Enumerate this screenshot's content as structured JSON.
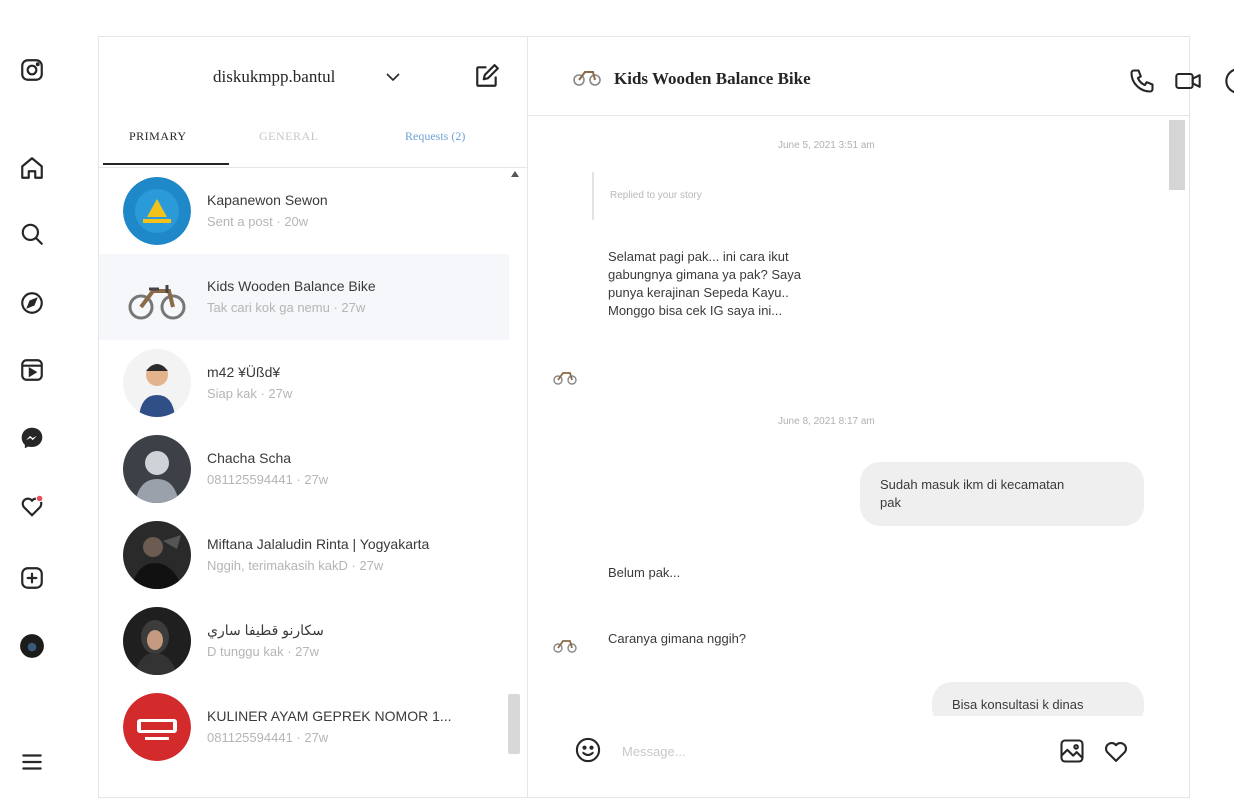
{
  "rail": {
    "icons": [
      "instagram-logo-icon",
      "home-icon",
      "search-icon",
      "explore-icon",
      "reels-icon",
      "messenger-icon",
      "notifications-heart-icon",
      "create-icon",
      "profile-avatar-icon",
      "menu-icon"
    ],
    "notification_dot_color": "#ed4956"
  },
  "conversations": {
    "account_name": "diskukmpp.bantul",
    "tabs": {
      "primary": "PRIMARY",
      "general": "GENERAL",
      "requests": "Requests (2)"
    },
    "threads": [
      {
        "name": "Kapanewon Sewon",
        "subtitle": "Sent a post · 20w",
        "avatar_color": "#1e88c8"
      },
      {
        "name": "Kids Wooden Balance Bike",
        "subtitle": "Tak cari kok ga nemu · 27w",
        "avatar_color": "#f0f0f0",
        "active": true
      },
      {
        "name": "m42 ¥Üßd¥",
        "subtitle": "Siap kak · 27w",
        "avatar_color": "#f3f3f3"
      },
      {
        "name": "Chacha Scha",
        "subtitle": "081125594441 · 27w",
        "avatar_color": "#3d4047"
      },
      {
        "name": "Miftana Jalaludin Rinta | Yogyakarta",
        "subtitle": "Nggih, terimakasih kakD · 27w",
        "avatar_color": "#2a2a2a"
      },
      {
        "name": "سكارنو قطيفا ساري",
        "subtitle": "D tunggu kak · 27w",
        "avatar_color": "#1f1f1f"
      },
      {
        "name": "KULINER AYAM GEPREK NOMOR 1...",
        "subtitle": "081125594441 · 27w",
        "avatar_color": "#d32b2b"
      }
    ]
  },
  "chat": {
    "title": "Kids Wooden Balance Bike",
    "timestamp_1": "June 5, 2021 3:51 am",
    "replied_label": "Replied to your story",
    "incoming_1": [
      "Selamat pagi pak... ini cara ikut",
      "gabungnya gimana ya pak? Saya",
      "punya kerajinan Sepeda Kayu..",
      "Monggo bisa cek IG saya ini..."
    ],
    "timestamp_2": "June 8, 2021 8:17 am",
    "outgoing_1": [
      "Sudah masuk ikm di kecamatan",
      "pak"
    ],
    "incoming_2": "Belum pak...",
    "incoming_3": "Caranya gimana nggih?",
    "outgoing_2": "Bisa konsultasi k dinas",
    "input_placeholder": "Message..."
  }
}
